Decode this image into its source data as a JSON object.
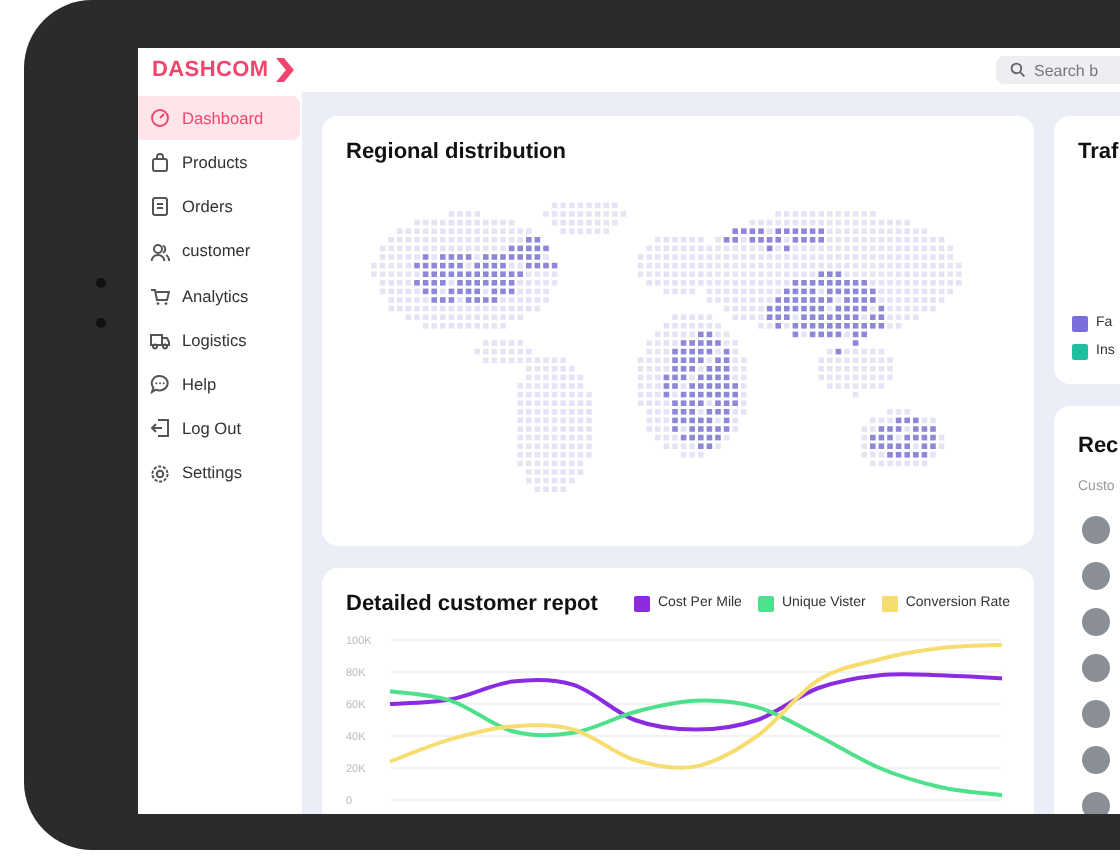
{
  "brand": {
    "name": "DASHCOM"
  },
  "search": {
    "placeholder": "Search b"
  },
  "sidebar": {
    "items": [
      {
        "label": "Dashboard",
        "selected": true
      },
      {
        "label": "Products",
        "selected": false
      },
      {
        "label": "Orders",
        "selected": false
      },
      {
        "label": "customer",
        "selected": false
      },
      {
        "label": "Analytics",
        "selected": false
      },
      {
        "label": "Logistics",
        "selected": false
      },
      {
        "label": "Help",
        "selected": false
      },
      {
        "label": "Log Out",
        "selected": false
      },
      {
        "label": "Settings",
        "selected": false
      }
    ]
  },
  "regional": {
    "title": "Regional distribution"
  },
  "report": {
    "title": "Detailed customer repot",
    "chart_data": {
      "type": "line",
      "grid": true,
      "ylim": [
        0,
        100000
      ],
      "yticks": [
        {
          "value": 0,
          "label": "0"
        },
        {
          "value": 20000,
          "label": "20K"
        },
        {
          "value": 40000,
          "label": "40K"
        },
        {
          "value": 60000,
          "label": "60K"
        },
        {
          "value": 80000,
          "label": "80K"
        },
        {
          "value": 100000,
          "label": "100K"
        }
      ],
      "series": [
        {
          "name": "Cost Per Mile",
          "color": "#8a2be2",
          "values": [
            60000,
            63000,
            74000,
            72000,
            50000,
            44000,
            50000,
            70000,
            78000,
            78000,
            76000
          ]
        },
        {
          "name": "Unique Vister",
          "color": "#4ee08a",
          "values": [
            68000,
            62000,
            43000,
            42000,
            55000,
            62000,
            58000,
            40000,
            20000,
            8000,
            3000
          ]
        },
        {
          "name": "Conversion Rate",
          "color": "#f7dc6f",
          "values": [
            24000,
            38000,
            46000,
            44000,
            25000,
            21000,
            40000,
            75000,
            88000,
            95000,
            97000
          ]
        }
      ]
    }
  },
  "traffic": {
    "title": "Traf",
    "legend": [
      {
        "label": "Fa",
        "color": "#7b6fe0"
      },
      {
        "label": "Ins",
        "color": "#1fbf9f"
      }
    ]
  },
  "recent": {
    "title": "Rec",
    "subtitle": "Custo"
  }
}
